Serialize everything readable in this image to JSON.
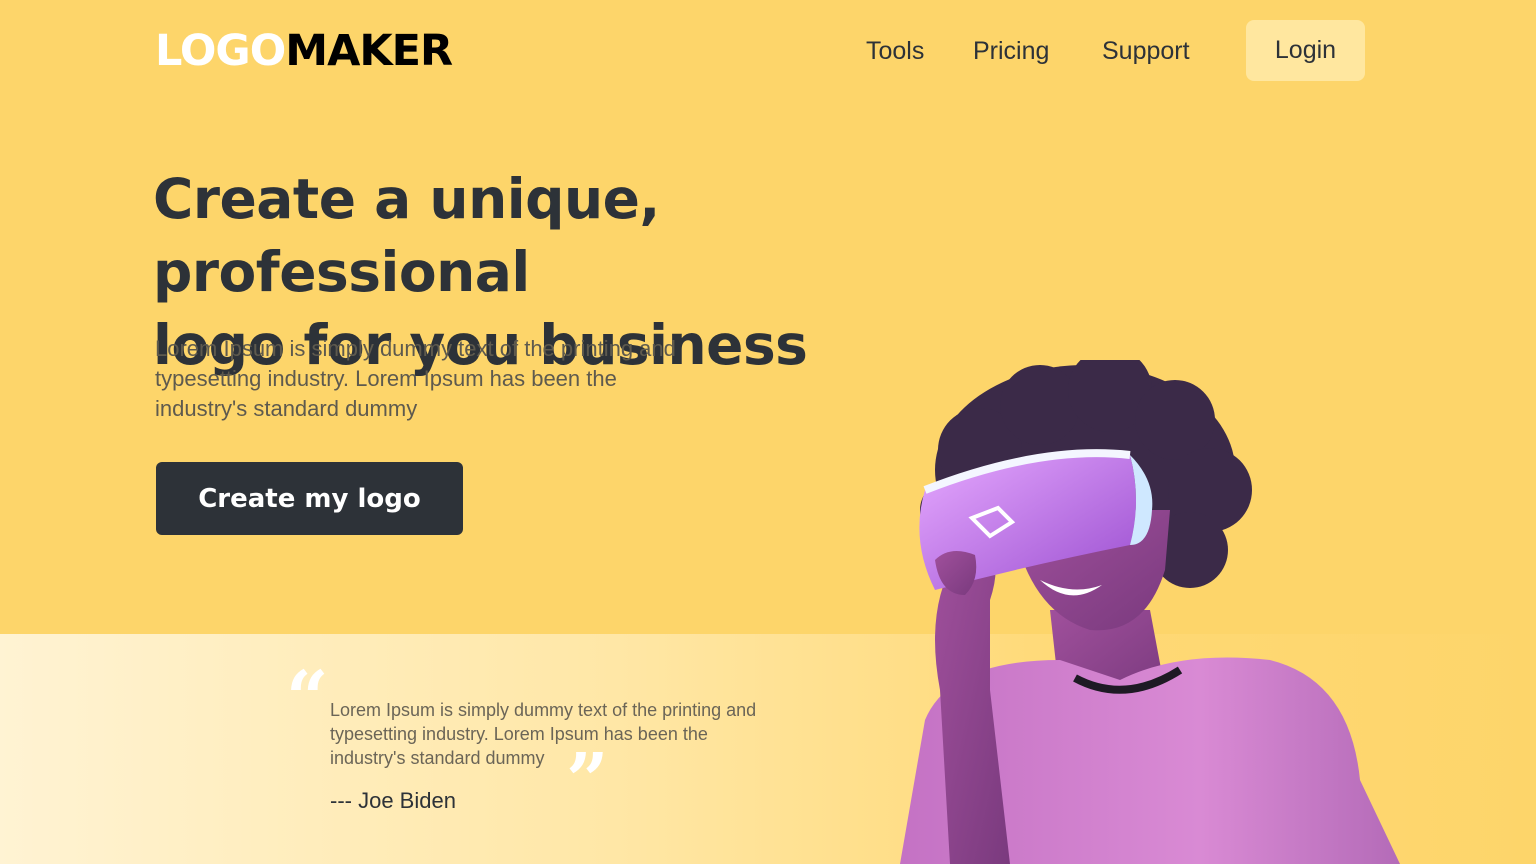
{
  "header": {
    "logo_part1": "LOGO",
    "logo_part2": "MAKER",
    "nav": [
      "Tools",
      "Pricing",
      "Support"
    ],
    "login_label": "Login"
  },
  "hero": {
    "title_line1": "Create a unique, professional",
    "title_line2": "logo for you business",
    "description_line1": "Lorem Ipsum is simply dummy text of the printing and",
    "description_line2": "typesetting industry. Lorem Ipsum has been the",
    "description_line3": "industry's standard dummy",
    "cta_label": "Create my logo",
    "image_icon": "woman-with-vr-headset"
  },
  "testimonial": {
    "quote_line1": "Lorem Ipsum is simply dummy text of the printing and",
    "quote_line2": "typesetting industry. Lorem Ipsum has been the",
    "quote_line3": "industry's standard dummy",
    "author": "--- Joe Biden",
    "open_mark": "“",
    "close_mark": "”"
  },
  "colors": {
    "background": "#fdd56a",
    "band_start": "#fff3d3",
    "dark": "#2d3238",
    "login_bg": "#ffe79f",
    "accent_pink": "#d36bd8"
  }
}
